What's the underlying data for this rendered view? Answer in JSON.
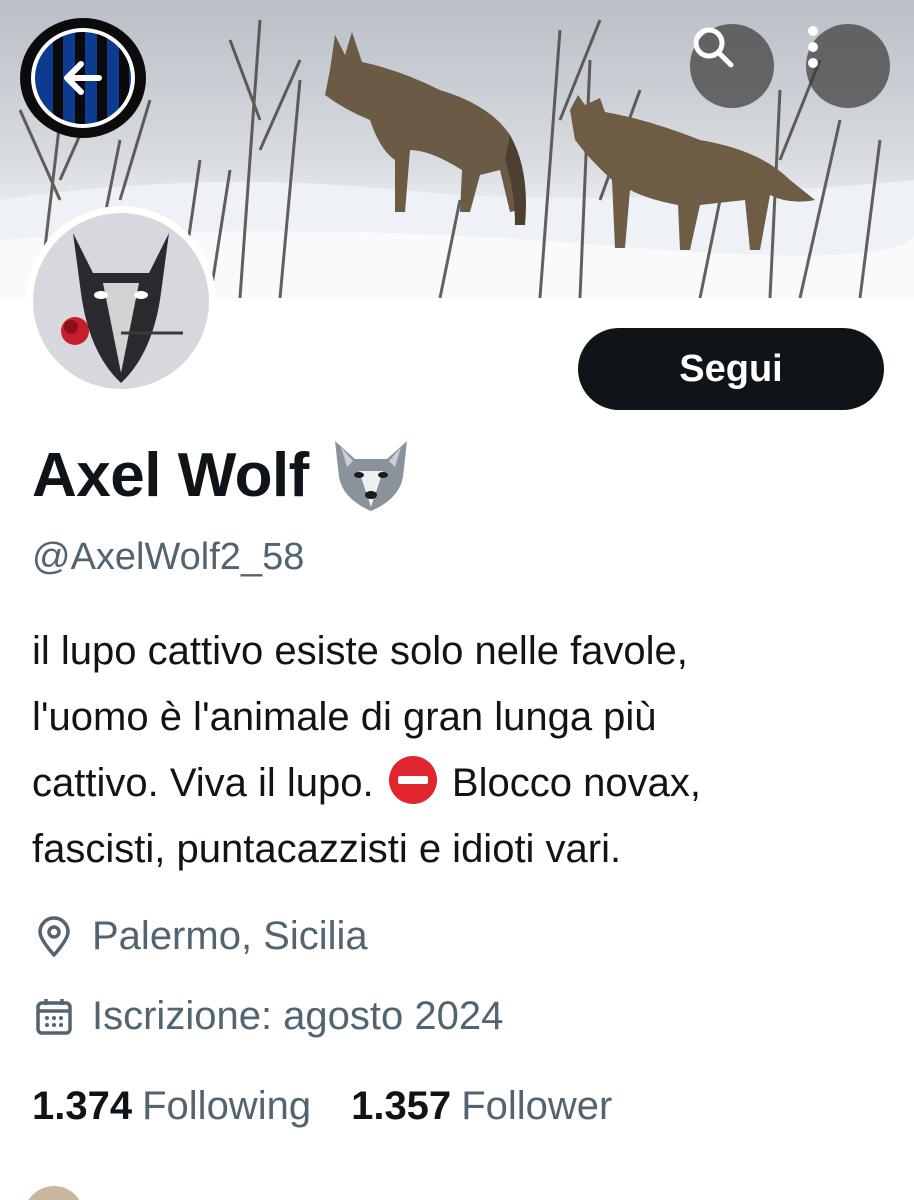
{
  "header": {
    "back_icon": "arrow-left-icon",
    "search_icon": "search-icon",
    "more_icon": "more-vertical-icon"
  },
  "profile": {
    "display_name": "Axel Wolf",
    "name_emoji": "wolf-face-emoji",
    "handle": "@AxelWolf2_58",
    "follow_label": "Segui",
    "bio": {
      "line1": "il lupo cattivo esiste solo nelle favole,",
      "line2": "l'uomo è l'animale di gran lunga più",
      "line3a": "cattivo. Viva il lupo.",
      "line3b": "Blocco novax,",
      "line4": "fascisti, puntacazzisti e idioti vari."
    },
    "location": "Palermo, Sicilia",
    "joined": "Iscrizione: agosto 2024",
    "stats": {
      "following_count": "1.374",
      "following_label": "Following",
      "followers_count": "1.357",
      "followers_label": "Follower"
    }
  },
  "colors": {
    "text": "#0f1419",
    "secondary": "#536471",
    "button_bg": "#0f1419",
    "no_entry": "#e0252f"
  }
}
